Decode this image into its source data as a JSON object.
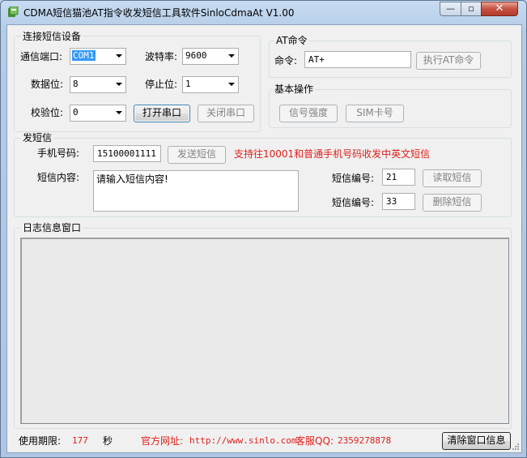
{
  "window": {
    "title": "CDMA短信猫池AT指令收发短信工具软件SinloCdmaAt V1.00",
    "controls": {
      "minimize": "—",
      "maximize": "▫",
      "close": "✕"
    }
  },
  "connect": {
    "group_label": "连接短信设备",
    "port_label": "通信端口:",
    "port_value": "COM1",
    "baud_label": "波特率:",
    "baud_value": "9600",
    "databits_label": "数据位:",
    "databits_value": "8",
    "stopbits_label": "停止位:",
    "stopbits_value": "1",
    "parity_label": "校验位:",
    "parity_value": "0",
    "open_button": "打开串口",
    "close_button": "关闭串口"
  },
  "at": {
    "group_label": "AT命令",
    "cmd_label": "命令:",
    "cmd_value": "AT+",
    "exec_button": "执行AT命令"
  },
  "basic": {
    "group_label": "基本操作",
    "signal_button": "信号强度",
    "sim_button": "SIM卡号"
  },
  "sms": {
    "group_label": "发短信",
    "phone_label": "手机号码:",
    "phone_value": "15100001111",
    "send_button": "发送短信",
    "note": "支持往10001和普通手机号码收发中英文短信",
    "content_label": "短信内容:",
    "content_value": "请输入短信内容!",
    "read_id_label": "短信编号:",
    "read_id_value": "21",
    "read_button": "读取短信",
    "del_id_label": "短信编号:",
    "del_id_value": "33",
    "del_button": "删除短信"
  },
  "log": {
    "group_label": "日志信息窗口"
  },
  "status": {
    "period_label": "使用期限:",
    "period_value": "177",
    "period_unit": "秒",
    "site_label": "官方网址:",
    "site_value": "http://www.sinlo.com",
    "qq_label": "客服QQ:",
    "qq_value": "2359278878",
    "clear_button": "清除窗口信息"
  },
  "colors": {
    "accent_red": "#e0201b",
    "selection": "#3399ff"
  }
}
